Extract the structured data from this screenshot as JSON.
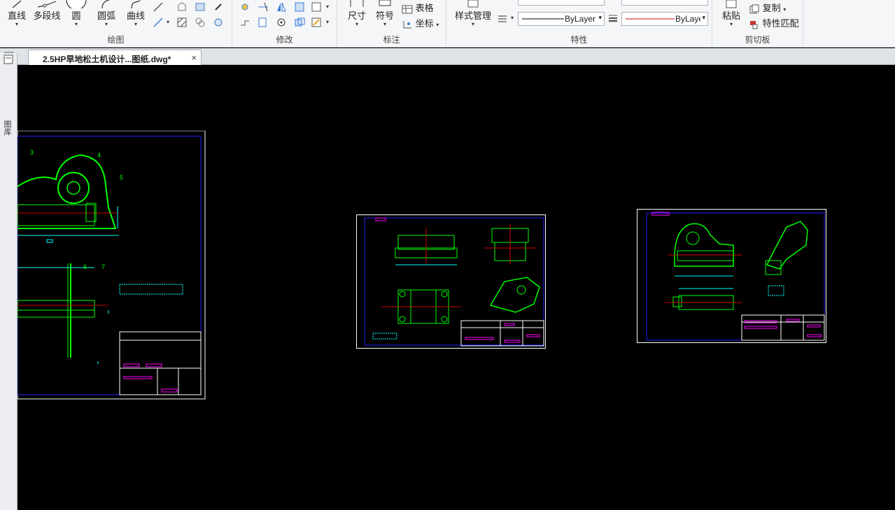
{
  "ribbon": {
    "draw_group": {
      "label": "绘图",
      "line": "直线",
      "polyline": "多段线",
      "circle": "圆",
      "arc": "圆弧",
      "curve": "曲线"
    },
    "modify_group": {
      "label": "修改"
    },
    "annotate_group": {
      "label": "标注",
      "dimension": "尺寸",
      "symbol": "符号",
      "table": "表格",
      "coordinate": "坐标"
    },
    "properties_group": {
      "label": "特性",
      "style_manager": "样式管理",
      "linetype": "ByLayer",
      "lineweight": "ByLayer"
    },
    "clipboard_group": {
      "label": "剪切板",
      "paste": "粘贴",
      "copy": "复制",
      "match_properties": "特性匹配"
    }
  },
  "tabs": {
    "document": "2.5HP旱地松土机设计...图纸.dwg*",
    "close": "×"
  },
  "side_panel": {
    "label": "图库"
  },
  "colors": {
    "accent_line": "#cc0000",
    "dimension": "#00ffff",
    "geometry": "#00ff00",
    "frame": "#ffffff",
    "border": "#2020ff",
    "highlight": "#ff00ff"
  }
}
